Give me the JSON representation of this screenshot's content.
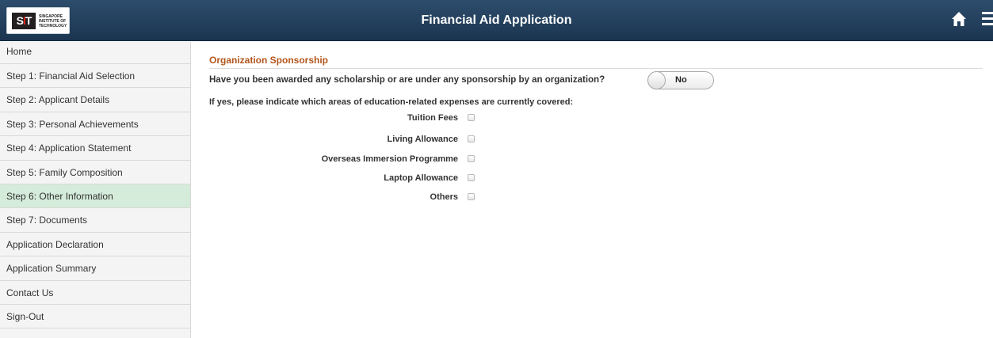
{
  "header": {
    "title": "Financial Aid Application",
    "logo_mark": "SIT",
    "logo_lines": [
      "SINGAPORE",
      "INSTITUTE OF",
      "TECHNOLOGY"
    ],
    "home_icon": "home-icon",
    "menu_icon": "hamburger-menu-icon"
  },
  "sidebar": {
    "items": [
      {
        "label": "Home",
        "active": false
      },
      {
        "label": "Step 1: Financial Aid Selection",
        "active": false
      },
      {
        "label": "Step 2: Applicant Details",
        "active": false
      },
      {
        "label": "Step 3: Personal Achievements",
        "active": false
      },
      {
        "label": "Step 4: Application Statement",
        "active": false
      },
      {
        "label": "Step 5: Family Composition",
        "active": false
      },
      {
        "label": "Step 6: Other Information",
        "active": true
      },
      {
        "label": "Step 7: Documents",
        "active": false
      },
      {
        "label": "Application Declaration",
        "active": false
      },
      {
        "label": "Application Summary",
        "active": false
      },
      {
        "label": "Contact Us",
        "active": false
      },
      {
        "label": "Sign-Out",
        "active": false
      }
    ],
    "active_color": "#d4ecd9"
  },
  "main": {
    "section_title": "Organization Sponsorship",
    "question": "Have you been awarded any scholarship or are under any sponsorship by an organization?",
    "toggle_value": "No",
    "covered_question": "If yes, please indicate which areas of education-related expenses are currently covered:",
    "options": [
      {
        "label": "Tuition Fees",
        "checked": false
      },
      {
        "label": "Living Allowance",
        "checked": false
      },
      {
        "label": "Overseas Immersion Programme",
        "checked": false
      },
      {
        "label": "Laptop Allowance",
        "checked": false
      },
      {
        "label": "Others",
        "checked": false
      }
    ]
  },
  "colors": {
    "header_bg": "#24415f",
    "section_title": "#b3551b"
  }
}
